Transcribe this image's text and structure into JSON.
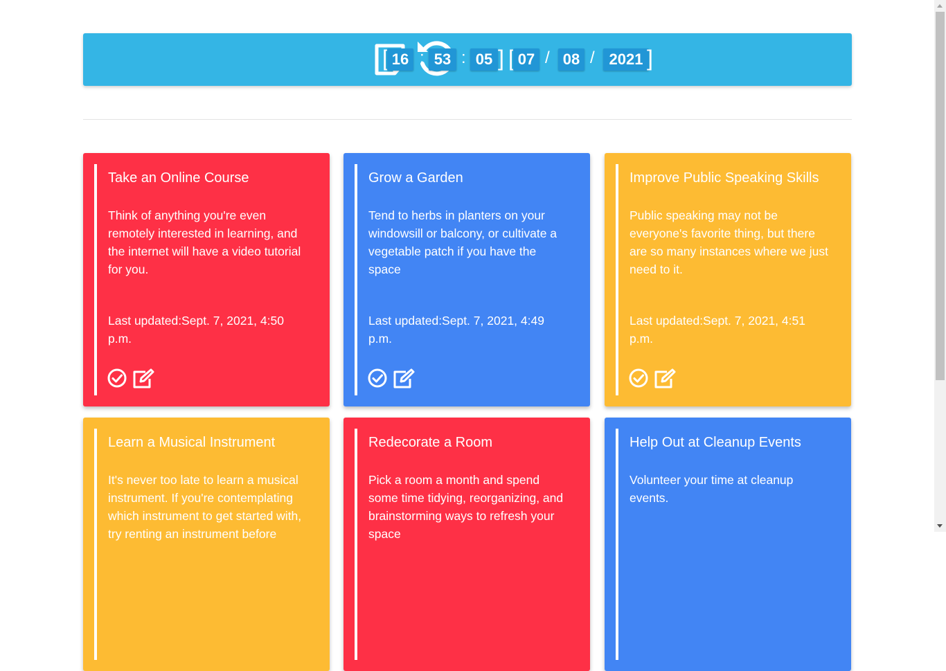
{
  "header": {
    "note_icon": "sticky-note-icon",
    "history_icon": "history-icon",
    "clock": {
      "hours": "16",
      "minutes": "53",
      "seconds": "05",
      "day": "07",
      "month": "08",
      "year": "2021",
      "time_separator": ":",
      "date_separator": "/",
      "bracket_open": "[",
      "bracket_close": "]"
    },
    "bg_color": "#34b5e5"
  },
  "colors": {
    "red": "#fe3046",
    "blue": "#4285f4",
    "yellow": "#fdbb33"
  },
  "cards": [
    {
      "title": "Take an Online Course",
      "description": "Think of anything you're even remotely interested in learning, and the internet will have a video tutorial for you.",
      "updated": "Last updated:Sept. 7, 2021, 4:50 p.m.",
      "color": "red"
    },
    {
      "title": "Grow a Garden",
      "description": "Tend to herbs in planters on your windowsill or balcony, or cultivate a vegetable patch if you have the space",
      "updated": "Last updated:Sept. 7, 2021, 4:49 p.m.",
      "color": "blue"
    },
    {
      "title": "Improve Public Speaking Skills",
      "description": "Public speaking may not be everyone's favorite thing, but there are so many instances where we just need to it.",
      "updated": "Last updated:Sept. 7, 2021, 4:51 p.m.",
      "color": "yellow"
    },
    {
      "title": "Learn a Musical Instrument",
      "description": "It's never too late to learn a musical instrument. If you're contemplating which instrument to get started with, try renting an instrument before",
      "updated": "",
      "color": "yellow"
    },
    {
      "title": "Redecorate a Room",
      "description": "Pick a room a month and spend some time tidying, reorganizing, and brainstorming ways to refresh your space",
      "updated": "",
      "color": "red"
    },
    {
      "title": "Help Out at Cleanup Events",
      "description": "Volunteer your time at cleanup events.",
      "updated": "",
      "color": "blue"
    }
  ],
  "card_icons": {
    "check": "check-circle-icon",
    "edit": "edit-icon"
  }
}
